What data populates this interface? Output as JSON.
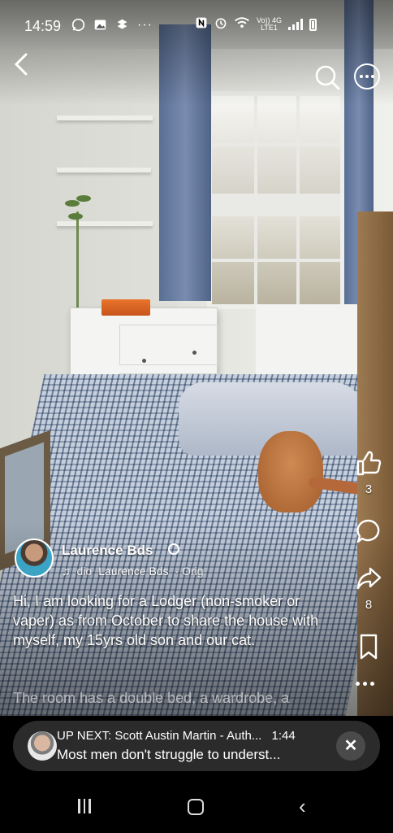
{
  "status_bar": {
    "time": "14:59",
    "left_icons": [
      "whatsapp-icon",
      "gallery-icon",
      "dropbox-icon",
      "more-notifications-icon"
    ],
    "right_icons": [
      "nfc-icon",
      "alarm-icon",
      "wifi-icon",
      "volte-lte-icon",
      "signal-icon",
      "battery-icon"
    ],
    "volte_top": "Vo)) 4G",
    "volte_bottom": "LTE1"
  },
  "top_nav": {
    "back_icon": "back-arrow-icon",
    "search_icon": "search-icon",
    "more_icon": "more-options-icon"
  },
  "actions": {
    "like_count": "3",
    "share_count": "8",
    "like_icon": "thumbs-up-icon",
    "comment_icon": "comment-icon",
    "share_icon": "share-icon",
    "save_icon": "bookmark-icon"
  },
  "post": {
    "author": "Laurence Bds",
    "audio_prefix": "dio",
    "audio_author": "Laurence Bds",
    "audio_suffix": "· Orig",
    "caption": "Hi, I am looking for a Lodger (non-smoker or vaper) as from October to share the house with myself, my 15yrs old son and our cat.",
    "caption_more": "The room has a double bed, a wardrobe, a"
  },
  "up_next": {
    "label": "UP NEXT: Scott Austin Martin - Auth...",
    "duration": "1:44",
    "title": "Most men don't struggle to underst..."
  },
  "colors": {
    "overlay": "#2b2b2b",
    "close_bg": "#4a4a4a"
  }
}
